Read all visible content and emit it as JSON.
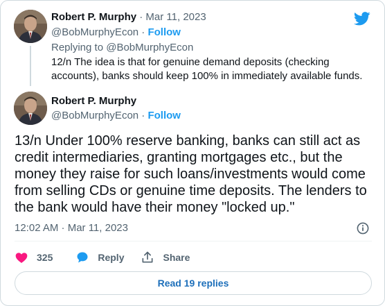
{
  "first_tweet": {
    "author_name": "Robert P. Murphy",
    "separator": " · ",
    "date": "Mar 11, 2023",
    "handle": "@BobMurphyEcon",
    "dot": " · ",
    "follow_label": "Follow",
    "replying_to": "Replying to @BobMurphyEcon",
    "text": "12/n The idea is that for genuine demand deposits (checking accounts), banks should keep 100% in immediately available funds."
  },
  "main_tweet": {
    "author_name": "Robert P. Murphy",
    "handle": "@BobMurphyEcon",
    "dot": " · ",
    "follow_label": "Follow",
    "text": "13/n Under 100% reserve banking, banks can still act as credit intermediaries, granting mortgages etc., but the money they raise for such loans/investments would come from selling CDs or genuine time deposits. The lenders to the bank would have their money \"locked up.\"",
    "timestamp": "12:02 AM · Mar 11, 2023"
  },
  "actions": {
    "like_count": "325",
    "reply_label": "Reply",
    "share_label": "Share"
  },
  "read_replies_label": "Read 19 replies",
  "icons": {
    "brand": "twitter-bird-icon",
    "like": "heart-icon",
    "reply": "speech-bubble-icon",
    "share": "share-upload-icon",
    "info": "info-icon"
  },
  "colors": {
    "accent": "#1d9bf0",
    "like": "#f91880",
    "text": "#0f1419",
    "muted": "#536471",
    "border": "#cfd9de"
  }
}
